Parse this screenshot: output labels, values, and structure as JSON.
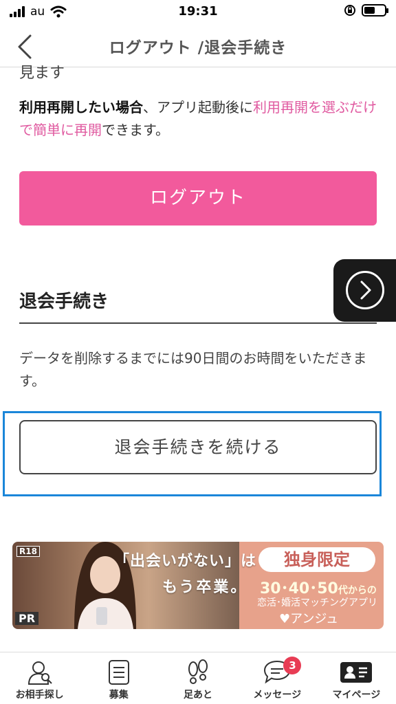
{
  "status_bar": {
    "carrier": "au",
    "time": "19:31"
  },
  "nav": {
    "title": "ログアウト /退会手続き"
  },
  "content": {
    "cut_text": "見ます",
    "info_bold": "利用再開したい場合",
    "info_text1": "、アプリ起動後に",
    "info_link": "利用再開を選ぶだけで簡単に再開",
    "info_text2": "できます。",
    "logout_button": "ログアウト",
    "section_title": "退会手続き",
    "description": "データを削除するまでには90日間のお時間をいただきます。",
    "continue_button": "退会手続きを続ける"
  },
  "ad": {
    "r18": "R18",
    "pr": "PR",
    "catch1": "「出会いがない」は",
    "catch2": "もう卒業。",
    "badge": "独身限定",
    "ages": "30･40･50",
    "ages_suffix": "代からの",
    "sub": "恋活･婚活マッチングアプリ",
    "brand": "♥アンジュ"
  },
  "tabs": [
    {
      "label": "お相手探し",
      "icon": "search-person-icon"
    },
    {
      "label": "募集",
      "icon": "document-icon"
    },
    {
      "label": "足あと",
      "icon": "footprints-icon"
    },
    {
      "label": "メッセージ",
      "icon": "chat-bubble-icon",
      "badge": "3"
    },
    {
      "label": "マイページ",
      "icon": "profile-card-icon"
    }
  ],
  "colors": {
    "accent": "#f25a9c",
    "link": "#e05aa0",
    "focus": "#1a86d9",
    "badge": "#e83c54"
  }
}
